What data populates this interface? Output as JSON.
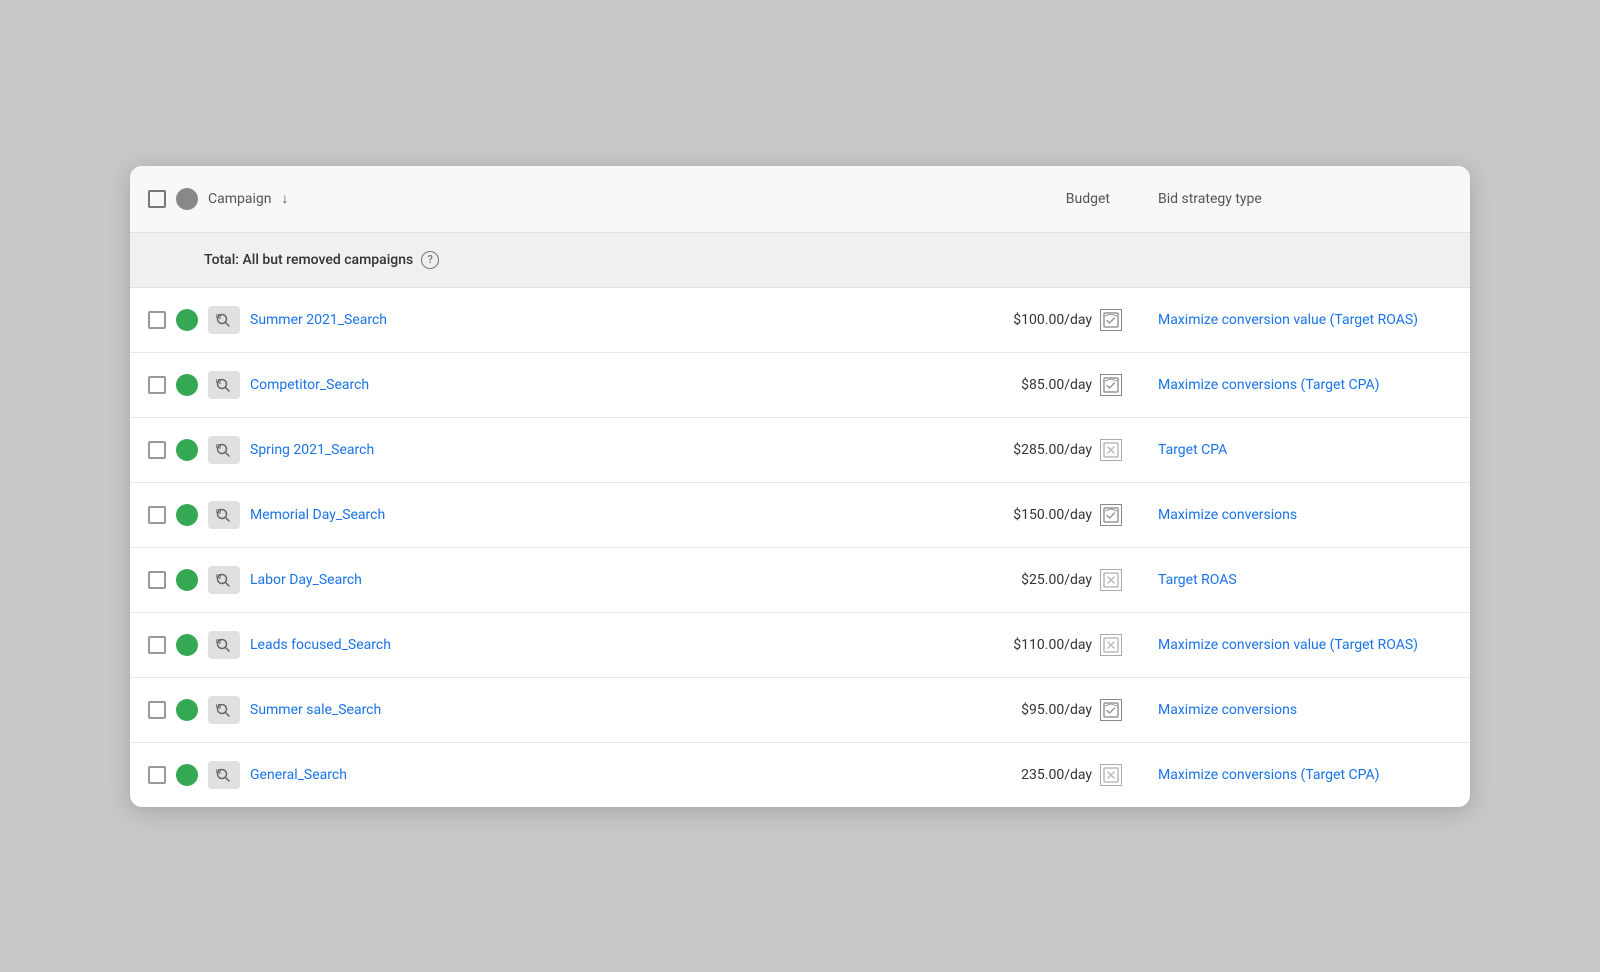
{
  "header": {
    "campaign_label": "Campaign",
    "budget_label": "Budget",
    "bid_strategy_label": "Bid strategy type"
  },
  "total_row": {
    "label": "Total: All but removed campaigns"
  },
  "campaigns": [
    {
      "id": 1,
      "name": "Summer 2021_Search",
      "budget": "$100.00/day",
      "budget_shared": true,
      "bid_strategy": "Maximize conversion value (Target ROAS)"
    },
    {
      "id": 2,
      "name": "Competitor_Search",
      "budget": "$85.00/day",
      "budget_shared": true,
      "bid_strategy": "Maximize conversions (Target CPA)"
    },
    {
      "id": 3,
      "name": "Spring 2021_Search",
      "budget": "$285.00/day",
      "budget_shared": false,
      "bid_strategy": "Target CPA"
    },
    {
      "id": 4,
      "name": "Memorial Day_Search",
      "budget": "$150.00/day",
      "budget_shared": true,
      "bid_strategy": "Maximize conversions"
    },
    {
      "id": 5,
      "name": "Labor Day_Search",
      "budget": "$25.00/day",
      "budget_shared": false,
      "bid_strategy": "Target ROAS"
    },
    {
      "id": 6,
      "name": "Leads focused_Search",
      "budget": "$110.00/day",
      "budget_shared": false,
      "bid_strategy": "Maximize conversion value (Target ROAS)"
    },
    {
      "id": 7,
      "name": "Summer sale_Search",
      "budget": "$95.00/day",
      "budget_shared": true,
      "bid_strategy": "Maximize conversions"
    },
    {
      "id": 8,
      "name": "General_Search",
      "budget": "235.00/day",
      "budget_shared": false,
      "bid_strategy": "Maximize conversions (Target CPA)"
    }
  ],
  "icons": {
    "search_magnifier": "🔍",
    "checkmark": "✓",
    "sort_down": "↓"
  }
}
